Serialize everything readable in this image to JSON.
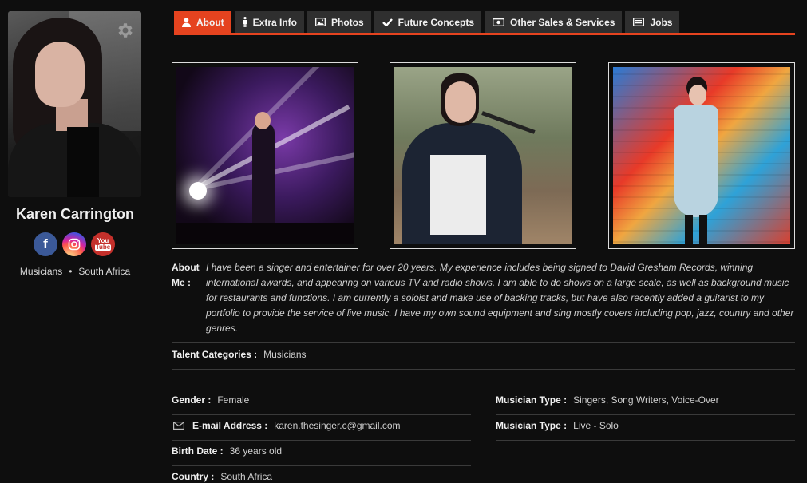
{
  "profile": {
    "name": "Karen Carrington",
    "category": "Musicians",
    "country": "South Africa",
    "separator": "•",
    "youtube_top": "You",
    "youtube_bottom": "Tube"
  },
  "tabs": [
    {
      "label": "About",
      "icon": "user-icon",
      "active": true
    },
    {
      "label": "Extra Info",
      "icon": "person-icon",
      "active": false
    },
    {
      "label": "Photos",
      "icon": "image-icon",
      "active": false
    },
    {
      "label": "Future Concepts",
      "icon": "check-icon",
      "active": false
    },
    {
      "label": "Other Sales & Services",
      "icon": "money-icon",
      "active": false
    },
    {
      "label": "Jobs",
      "icon": "list-icon",
      "active": false
    }
  ],
  "about": {
    "label": "About Me :",
    "text": "I have been a singer and entertainer for over 20 years. My experience includes being signed to David Gresham Records, winning international awards, and appearing on various TV and radio shows. I am able to do shows on a large scale, as well as background music for restaurants and functions. I am currently a soloist and make use of backing tracks, but have also recently added a guitarist to my portfolio to provide the service of live music. I have my own sound equipment and sing mostly covers including pop, jazz, country and other genres."
  },
  "talent": {
    "label": "Talent Categories :",
    "value": "Musicians"
  },
  "details_left": [
    {
      "label": "Gender :",
      "value": "Female"
    },
    {
      "label": "E-mail Address :",
      "value": "karen.thesinger.c@gmail.com"
    },
    {
      "label": "Birth Date :",
      "value": "36 years old"
    },
    {
      "label": "Country :",
      "value": "South Africa"
    }
  ],
  "details_right": [
    {
      "label": "Musician Type :",
      "value": "Singers, Song Writers, Voice-Over"
    },
    {
      "label": "Musician Type :",
      "value": "Live - Solo"
    }
  ],
  "colors": {
    "accent": "#e5431f",
    "tab_bg": "#2f2f2f",
    "background": "#0e0e0e"
  }
}
